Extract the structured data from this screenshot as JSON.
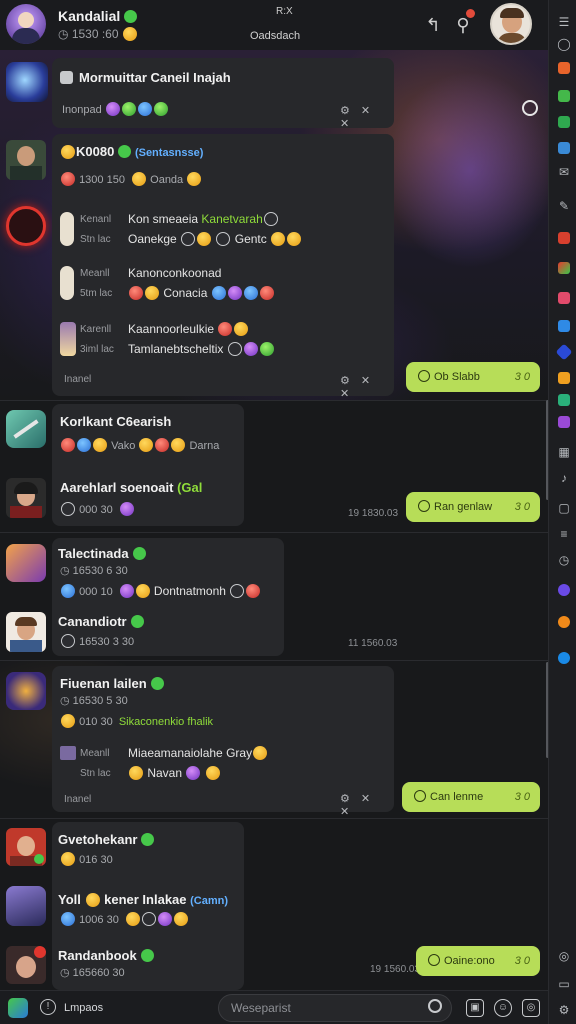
{
  "header": {
    "title": "Kandalial",
    "subtitle": "1530 :60",
    "center_label": "Oadsdach",
    "center_top": "R:X"
  },
  "cards": {
    "c1": {
      "title": "Mormuittar Caneil Inajah",
      "sub": "Inonpad",
      "tools": "⚙ ✕ ✕"
    },
    "c2": {
      "name": "K0080",
      "link": "(Sentasnsse)",
      "meta": "1300 150",
      "meta_tail": "Oanda",
      "rows": [
        {
          "a": "Kenanl",
          "b": "Kon smeaeia",
          "b2": "Kanetvarah",
          "c": "Stn lac",
          "d": "Oanekge",
          "d2": "Gentc"
        },
        {
          "a": "Meanll",
          "b": "Kanonconkoonad",
          "b2": "",
          "c": "5tm lac",
          "d": "Conacia",
          "d2": ""
        },
        {
          "a": "Karenll",
          "b": "Kaannoorleulkie",
          "b2": "",
          "c": "3iml lac",
          "d": "Tamlanebtscheltix",
          "d2": ""
        }
      ],
      "footer": "Inanel",
      "tools": "⚙ ✕ ✕"
    },
    "c3": {
      "title": "Korlkant C6earish",
      "meta": "Vako",
      "meta2": "Darna"
    },
    "c4": {
      "name": "Aarehlarl soenoait",
      "name_tag": "(Gal",
      "meta": "000 30"
    },
    "c5": {
      "name": "Talectinada",
      "sub": "16530 6 30",
      "meta": "000 10",
      "meta2": "Dontnatmonh"
    },
    "c6": {
      "name": "Canandiotr",
      "sub": "16530 3 30"
    },
    "c7": {
      "name": "Fiuenan lailen",
      "sub": "16530 5 30",
      "meta": "010 30",
      "meta2": "Sikaconenkio fhalik",
      "row_a": "Meanll",
      "row_b": "Miaeamanaiolahe",
      "row_b2": "Gray",
      "row_c": "Stn lac",
      "row_d": "Navan",
      "footer": "Inanel"
    },
    "c8": {
      "name": "Gvetohekanr",
      "meta": "016 30"
    },
    "c9": {
      "name": "Yoll",
      "name_b": "kener Inlakae",
      "link": "(Camn)",
      "meta": "1006 30"
    },
    "c10": {
      "name": "Randanbook",
      "sub": "165660 30"
    }
  },
  "bubbles": [
    {
      "text": "Ob Slabb",
      "time": "3 0"
    },
    {
      "text": "Ran genlaw",
      "time": "3 0"
    },
    {
      "text": "Can lenme",
      "time": "3 0"
    },
    {
      "text": "Oaine:ono",
      "time": "3 0"
    }
  ],
  "timestamps": [
    "19 1830.03",
    "11 1560.03",
    "19 1560.03"
  ],
  "composer": {
    "left_label": "Lmpaos",
    "placeholder": "Weseparist"
  },
  "colors": {
    "accent": "#b7dd58",
    "bg": "#18191b",
    "card": "#27282b",
    "online": "#46c84a",
    "link": "#63b0ff"
  }
}
